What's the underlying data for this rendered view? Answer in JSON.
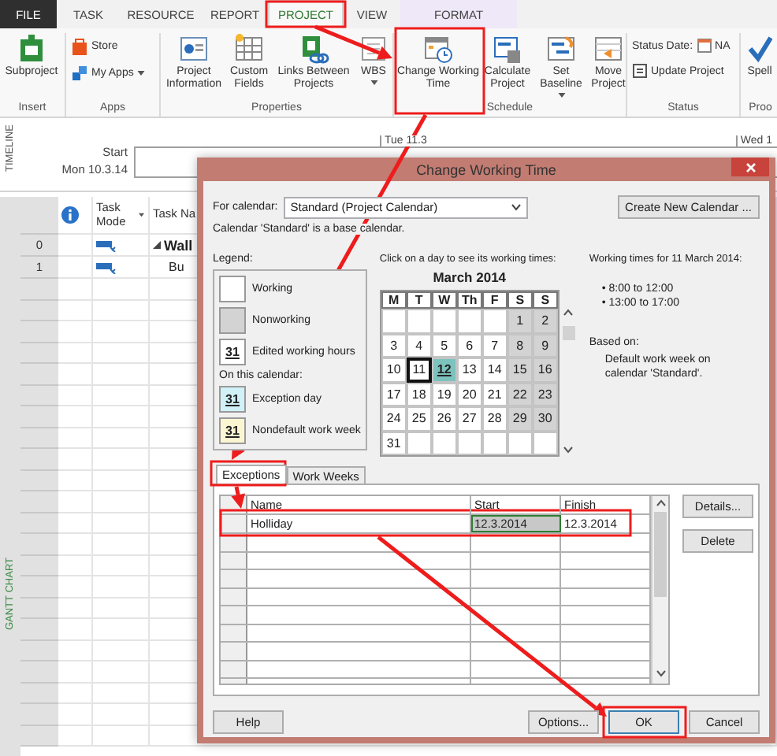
{
  "tabs": [
    {
      "label": "FILE",
      "kind": "file",
      "selected": false
    },
    {
      "label": "TASK",
      "kind": "normal",
      "selected": false
    },
    {
      "label": "RESOURCE",
      "kind": "normal",
      "selected": false
    },
    {
      "label": "REPORT",
      "kind": "normal",
      "selected": false
    },
    {
      "label": "PROJECT",
      "kind": "normal",
      "selected": true
    },
    {
      "label": "VIEW",
      "kind": "normal",
      "selected": false
    },
    {
      "label": "FORMAT",
      "kind": "contextual",
      "selected": false
    }
  ],
  "ribbon": {
    "groups": [
      {
        "label": "Insert",
        "items": [
          {
            "label": "Subproject",
            "kind": "large",
            "dropdown": false
          }
        ]
      },
      {
        "label": "Apps",
        "items": [
          {
            "label": "Store",
            "kind": "small",
            "dropdown": false
          },
          {
            "label": "My Apps",
            "kind": "small",
            "dropdown": true
          }
        ]
      },
      {
        "label": "Properties",
        "items": [
          {
            "label": "Project Information",
            "kind": "large",
            "dropdown": false
          },
          {
            "label": "Custom Fields",
            "kind": "large",
            "dropdown": false
          },
          {
            "label": "Links Between Projects",
            "kind": "large",
            "dropdown": false
          },
          {
            "label": "WBS",
            "kind": "large",
            "dropdown": true
          }
        ]
      },
      {
        "label": "Schedule",
        "items": [
          {
            "label": "Change Working Time",
            "kind": "large",
            "dropdown": false
          },
          {
            "label": "Calculate Project",
            "kind": "large",
            "dropdown": false
          },
          {
            "label": "Set Baseline",
            "kind": "large",
            "dropdown": true
          },
          {
            "label": "Move Project",
            "kind": "large",
            "dropdown": false
          }
        ]
      },
      {
        "label": "Status",
        "items": [
          {
            "label": "Status Date:",
            "value": "NA",
            "kind": "small",
            "dropdown": false
          },
          {
            "label": "Update Project",
            "kind": "small",
            "dropdown": false
          }
        ]
      },
      {
        "label": "Proo",
        "items": [
          {
            "label": "Spell",
            "kind": "large",
            "dropdown": false
          }
        ]
      }
    ]
  },
  "timeline": {
    "side_label": "TIMELINE",
    "start_label": "Start",
    "start_date": "Mon 10.3.14",
    "ticks": [
      "Tue 11.3",
      "Wed 1"
    ]
  },
  "gantt": {
    "side_label": "GANTT CHART",
    "columns": [
      "Task Mode",
      "Task Na"
    ],
    "rows": [
      {
        "id": "0",
        "name": "Wall",
        "summary": true
      },
      {
        "id": "1",
        "name": "Bu",
        "summary": false
      }
    ]
  },
  "dialog": {
    "title": "Change Working Time",
    "calendar_label": "For calendar:",
    "calendar_value": "Standard (Project Calendar)",
    "create_button": "Create New Calendar ...",
    "note": "Calendar 'Standard' is a base calendar.",
    "legend": {
      "title": "Legend:",
      "items": [
        {
          "label": "Working",
          "kind": "working"
        },
        {
          "label": "Nonworking",
          "kind": "nonworking"
        },
        {
          "label": "Edited working hours",
          "kind": "edited",
          "sample": "31"
        }
      ],
      "section_label": "On this calendar:",
      "calendar_items": [
        {
          "label": "Exception day",
          "kind": "exception",
          "sample": "31"
        },
        {
          "label": "Nondefault work week",
          "kind": "nondefault",
          "sample": "31"
        }
      ]
    },
    "calendar": {
      "hint": "Click on a day to see its working times:",
      "month": "March 2014",
      "weekdays": [
        "M",
        "T",
        "W",
        "Th",
        "F",
        "S",
        "S"
      ],
      "weeks": [
        [
          {
            "kind": "blank"
          },
          {
            "kind": "blank"
          },
          {
            "kind": "blank"
          },
          {
            "kind": "blank"
          },
          {
            "kind": "blank"
          },
          {
            "day": "1",
            "kind": "nonworking",
            "selected": false
          },
          {
            "day": "2",
            "kind": "nonworking",
            "selected": false
          }
        ],
        [
          {
            "day": "3",
            "kind": "working",
            "selected": false
          },
          {
            "day": "4",
            "kind": "working",
            "selected": false
          },
          {
            "day": "5",
            "kind": "working",
            "selected": false
          },
          {
            "day": "6",
            "kind": "working",
            "selected": false
          },
          {
            "day": "7",
            "kind": "working",
            "selected": false
          },
          {
            "day": "8",
            "kind": "nonworking",
            "selected": false
          },
          {
            "day": "9",
            "kind": "nonworking",
            "selected": false
          }
        ],
        [
          {
            "day": "10",
            "kind": "working",
            "selected": false
          },
          {
            "day": "11",
            "kind": "working",
            "selected": true
          },
          {
            "day": "12",
            "kind": "exception",
            "selected": false
          },
          {
            "day": "13",
            "kind": "working",
            "selected": false
          },
          {
            "day": "14",
            "kind": "working",
            "selected": false
          },
          {
            "day": "15",
            "kind": "nonworking",
            "selected": false
          },
          {
            "day": "16",
            "kind": "nonworking",
            "selected": false
          }
        ],
        [
          {
            "day": "17",
            "kind": "working",
            "selected": false
          },
          {
            "day": "18",
            "kind": "working",
            "selected": false
          },
          {
            "day": "19",
            "kind": "working",
            "selected": false
          },
          {
            "day": "20",
            "kind": "working",
            "selected": false
          },
          {
            "day": "21",
            "kind": "working",
            "selected": false
          },
          {
            "day": "22",
            "kind": "nonworking",
            "selected": false
          },
          {
            "day": "23",
            "kind": "nonworking",
            "selected": false
          }
        ],
        [
          {
            "day": "24",
            "kind": "working",
            "selected": false
          },
          {
            "day": "25",
            "kind": "working",
            "selected": false
          },
          {
            "day": "26",
            "kind": "working",
            "selected": false
          },
          {
            "day": "27",
            "kind": "working",
            "selected": false
          },
          {
            "day": "28",
            "kind": "working",
            "selected": false
          },
          {
            "day": "29",
            "kind": "nonworking",
            "selected": false
          },
          {
            "day": "30",
            "kind": "nonworking",
            "selected": false
          }
        ],
        [
          {
            "day": "31",
            "kind": "working",
            "selected": false
          },
          {
            "kind": "blank"
          },
          {
            "kind": "blank"
          },
          {
            "kind": "blank"
          },
          {
            "kind": "blank"
          },
          {
            "kind": "blank"
          },
          {
            "kind": "blank"
          }
        ]
      ]
    },
    "working_times": {
      "title": "Working times for 11 March 2014:",
      "times": [
        "• 8:00 to 12:00",
        "• 13:00 to 17:00"
      ],
      "based_on_label": "Based on:",
      "based_on": "Default work week on calendar 'Standard'."
    },
    "tabs": [
      {
        "label": "Exceptions",
        "selected": true
      },
      {
        "label": "Work Weeks",
        "selected": false
      }
    ],
    "exceptions": {
      "columns": [
        "Name",
        "Start",
        "Finish"
      ],
      "rows": [
        {
          "cells": [
            {
              "text": "Holliday",
              "selected": false
            },
            {
              "text": "12.3.2014",
              "selected": true
            },
            {
              "text": "12.3.2014",
              "selected": false
            }
          ]
        }
      ]
    },
    "side_buttons": [
      "Details...",
      "Delete"
    ],
    "buttons": [
      {
        "label": "Help",
        "kind": "left",
        "default": false
      },
      {
        "label": "Options...",
        "kind": "right",
        "default": false
      },
      {
        "label": "OK",
        "kind": "right",
        "default": true
      },
      {
        "label": "Cancel",
        "kind": "right",
        "default": false
      }
    ]
  }
}
